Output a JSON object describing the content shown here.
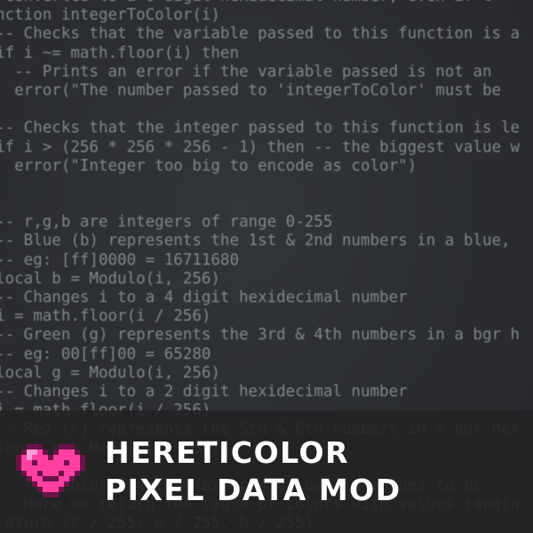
{
  "code_lines": [
    "-- converted to a 6 digit hexidecimal number, even if t",
    "function integerToColor(i)",
    "  -- Checks that the variable passed to this function is a",
    "  if i ~= math.floor(i) then",
    "    -- Prints an error if the variable passed is not an",
    "    error(\"The number passed to 'integerToColor' must be",
    "",
    "  -- Checks that the integer passed to this function is le",
    "  if i > (256 * 256 * 256 - 1) then -- the biggest value w",
    "    error(\"Integer too big to encode as color\")",
    "",
    "",
    "  -- r,g,b are integers of range 0-255",
    "  -- Blue (b) represents the 1st & 2nd numbers in a blue,",
    "  -- eg: [ff]0000 = 16711680",
    "  local b = Modulo(i, 256)",
    "  -- Changes i to a 4 digit hexidecimal number",
    "  i = math.floor(i / 256)",
    "  -- Green (g) represents the 3rd & 4th numbers in a bgr h",
    "  -- eg: 00[ff]00 = 65280",
    "  local g = Modulo(i, 256)",
    "  -- Changes i to a 2 digit hexidecimal number",
    "  i = math.floor(i / 256)",
    "  -- Red (r) represents the 5th & 6th numbers in a bgr hex",
    "  local r = Modulo(i, 256)",
    "",
    "  -- The Color function expects values in values to be",
    "  -- Here we return the table of colors with values rangin",
    "  return (r / 255, g / 255, b / 255)"
  ],
  "banner": {
    "title_line1": "HERETICOLOR",
    "title_line2": "PIXEL DATA MOD"
  },
  "icons": {
    "logo": "pixel-heart-face-icon"
  },
  "colors": {
    "heart_outline": "#6b1346",
    "heart_fill": "#ff3fa2",
    "heart_highlight": "#ff9fd6",
    "title_text": "#ffffff",
    "code_text": "#8a8d90"
  }
}
